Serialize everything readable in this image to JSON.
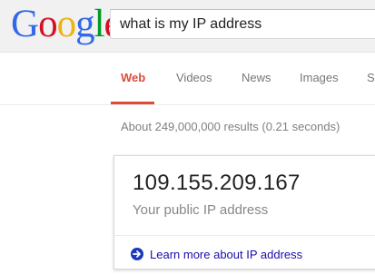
{
  "header": {
    "logo": {
      "letters": [
        "G",
        "o",
        "o",
        "g",
        "l",
        "e"
      ],
      "colors": [
        "#3369e8",
        "#d50f25",
        "#eeb211",
        "#3369e8",
        "#009925",
        "#d50f25"
      ]
    },
    "search": {
      "value": "what is my IP address"
    }
  },
  "tabs": {
    "items": [
      {
        "label": "Web",
        "active": true
      },
      {
        "label": "Videos",
        "active": false
      },
      {
        "label": "News",
        "active": false
      },
      {
        "label": "Images",
        "active": false
      },
      {
        "label": "S",
        "active": false
      }
    ],
    "accent_color": "#dd4b39"
  },
  "results": {
    "stats": "About 249,000,000 results (0.21 seconds)"
  },
  "answer_card": {
    "ip": "109.155.209.167",
    "caption": "Your public IP address",
    "learn_more_icon": "arrow-circle-right-icon",
    "learn_more_label": "Learn more about IP address"
  }
}
